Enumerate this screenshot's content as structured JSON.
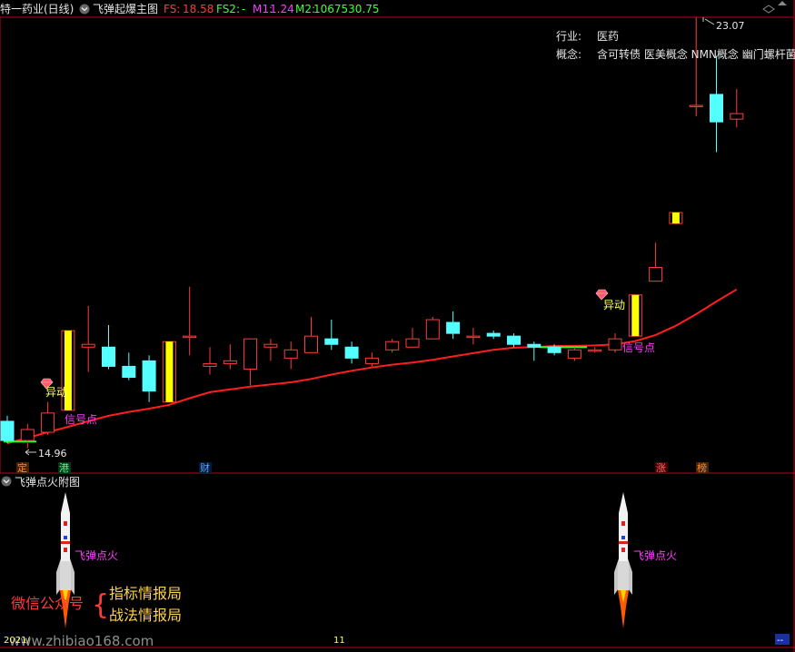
{
  "header": {
    "stock_name": "特一药业(日线)",
    "main_indicator": "飞弹起爆主图",
    "fs_label": "FS:",
    "fs_value": "18.58",
    "fs2_label": "FS2:",
    "fs2_value": "-",
    "m1_label": "M1:",
    "m1_value": "1.24",
    "m2_label": "M2:",
    "m2_value": "1067530.75"
  },
  "info": {
    "industry_label": "行业:",
    "industry_value": "医药",
    "concept_label": "概念:",
    "concept_value": "含可转债 医美概念 NMN概念 幽门螺杆菌"
  },
  "annotations": {
    "high_price": "23.07",
    "low_price": "14.96",
    "yidong": "异动",
    "signal": "信号点",
    "ignite": "飞弹点火"
  },
  "event_markers": [
    "定",
    "港",
    "财",
    "涨",
    "榜"
  ],
  "sub_panel": {
    "title": "飞弹点火附图"
  },
  "watermark": {
    "wechat": "微信公众号",
    "brace": "{",
    "name1": "指标情报局",
    "name2": "战法情报局",
    "site": "www.zhibiao168.com"
  },
  "footer": {
    "date_left": "2021/",
    "date_mid": "11",
    "btn": "--"
  },
  "colors": {
    "up": "#ff3c3c",
    "down": "#54ffff",
    "ma": "#ff1e1e",
    "signal_fill": "#ffff00",
    "magenta": "#ff3cff",
    "frame": "#c0001c"
  },
  "chart_data": {
    "type": "candlestick",
    "title": "飞弹起爆主图",
    "ylim": [
      14.5,
      23.3
    ],
    "candles": [
      {
        "o": 15.45,
        "h": 15.55,
        "l": 15.05,
        "c": 15.1
      },
      {
        "o": 15.1,
        "h": 15.4,
        "l": 14.96,
        "c": 15.3
      },
      {
        "o": 15.25,
        "h": 15.8,
        "l": 15.2,
        "c": 15.6
      },
      {
        "o": 15.65,
        "h": 17.1,
        "l": 15.65,
        "c": 17.1,
        "signal": true
      },
      {
        "o": 16.8,
        "h": 17.55,
        "l": 16.35,
        "c": 16.85
      },
      {
        "o": 16.8,
        "h": 17.2,
        "l": 16.4,
        "c": 16.45
      },
      {
        "o": 16.45,
        "h": 16.7,
        "l": 16.2,
        "c": 16.25
      },
      {
        "o": 16.55,
        "h": 16.65,
        "l": 15.8,
        "c": 16.0
      },
      {
        "o": 15.8,
        "h": 16.9,
        "l": 15.8,
        "c": 16.9,
        "signal": true
      },
      {
        "o": 17.0,
        "h": 17.9,
        "l": 16.65,
        "c": 17.0
      },
      {
        "o": 16.45,
        "h": 16.8,
        "l": 16.3,
        "c": 16.5
      },
      {
        "o": 16.5,
        "h": 16.85,
        "l": 16.4,
        "c": 16.55
      },
      {
        "o": 16.4,
        "h": 16.95,
        "l": 16.1,
        "c": 16.95
      },
      {
        "o": 16.8,
        "h": 16.95,
        "l": 16.55,
        "c": 16.85
      },
      {
        "o": 16.6,
        "h": 16.9,
        "l": 16.4,
        "c": 16.75
      },
      {
        "o": 16.7,
        "h": 17.35,
        "l": 16.7,
        "c": 17.0
      },
      {
        "o": 16.95,
        "h": 17.3,
        "l": 16.75,
        "c": 16.85
      },
      {
        "o": 16.8,
        "h": 16.9,
        "l": 16.5,
        "c": 16.6
      },
      {
        "o": 16.5,
        "h": 16.7,
        "l": 16.45,
        "c": 16.6
      },
      {
        "o": 16.75,
        "h": 16.95,
        "l": 16.7,
        "c": 16.9
      },
      {
        "o": 16.8,
        "h": 17.15,
        "l": 16.8,
        "c": 16.95
      },
      {
        "o": 16.95,
        "h": 17.35,
        "l": 16.95,
        "c": 17.3
      },
      {
        "o": 17.25,
        "h": 17.45,
        "l": 16.95,
        "c": 17.05
      },
      {
        "o": 17.0,
        "h": 17.15,
        "l": 16.85,
        "c": 17.0
      },
      {
        "o": 17.05,
        "h": 17.1,
        "l": 16.95,
        "c": 17.0
      },
      {
        "o": 17.0,
        "h": 17.05,
        "l": 16.8,
        "c": 16.85
      },
      {
        "o": 16.85,
        "h": 16.9,
        "l": 16.55,
        "c": 16.8
      },
      {
        "o": 16.8,
        "h": 16.85,
        "l": 16.65,
        "c": 16.7
      },
      {
        "o": 16.6,
        "h": 16.8,
        "l": 16.55,
        "c": 16.75
      },
      {
        "o": 16.75,
        "h": 16.8,
        "l": 16.7,
        "c": 16.75
      },
      {
        "o": 16.75,
        "h": 17.05,
        "l": 16.7,
        "c": 16.95
      },
      {
        "o": 17.0,
        "h": 17.75,
        "l": 17.0,
        "c": 17.75,
        "signal": true
      },
      {
        "o": 18.0,
        "h": 18.7,
        "l": 18.0,
        "c": 18.25
      },
      {
        "o": 19.05,
        "h": 19.25,
        "l": 19.05,
        "c": 19.25,
        "signal": true
      },
      {
        "o": 21.2,
        "h": 22.8,
        "l": 21.0,
        "c": 21.2
      },
      {
        "o": 21.4,
        "h": 22.1,
        "l": 20.35,
        "c": 20.9
      },
      {
        "o": 20.95,
        "h": 21.5,
        "l": 20.8,
        "c": 21.05
      }
    ],
    "ma_line": [
      15.05,
      15.15,
      15.25,
      15.35,
      15.45,
      15.55,
      15.62,
      15.68,
      15.75,
      15.87,
      15.98,
      16.03,
      16.08,
      16.12,
      16.16,
      16.22,
      16.3,
      16.37,
      16.43,
      16.48,
      16.52,
      16.57,
      16.63,
      16.69,
      16.75,
      16.79,
      16.8,
      16.82,
      16.82,
      16.83,
      16.85,
      16.91,
      17.02,
      17.19,
      17.4,
      17.63,
      17.85
    ],
    "ignite_signals": [
      2,
      31
    ]
  }
}
